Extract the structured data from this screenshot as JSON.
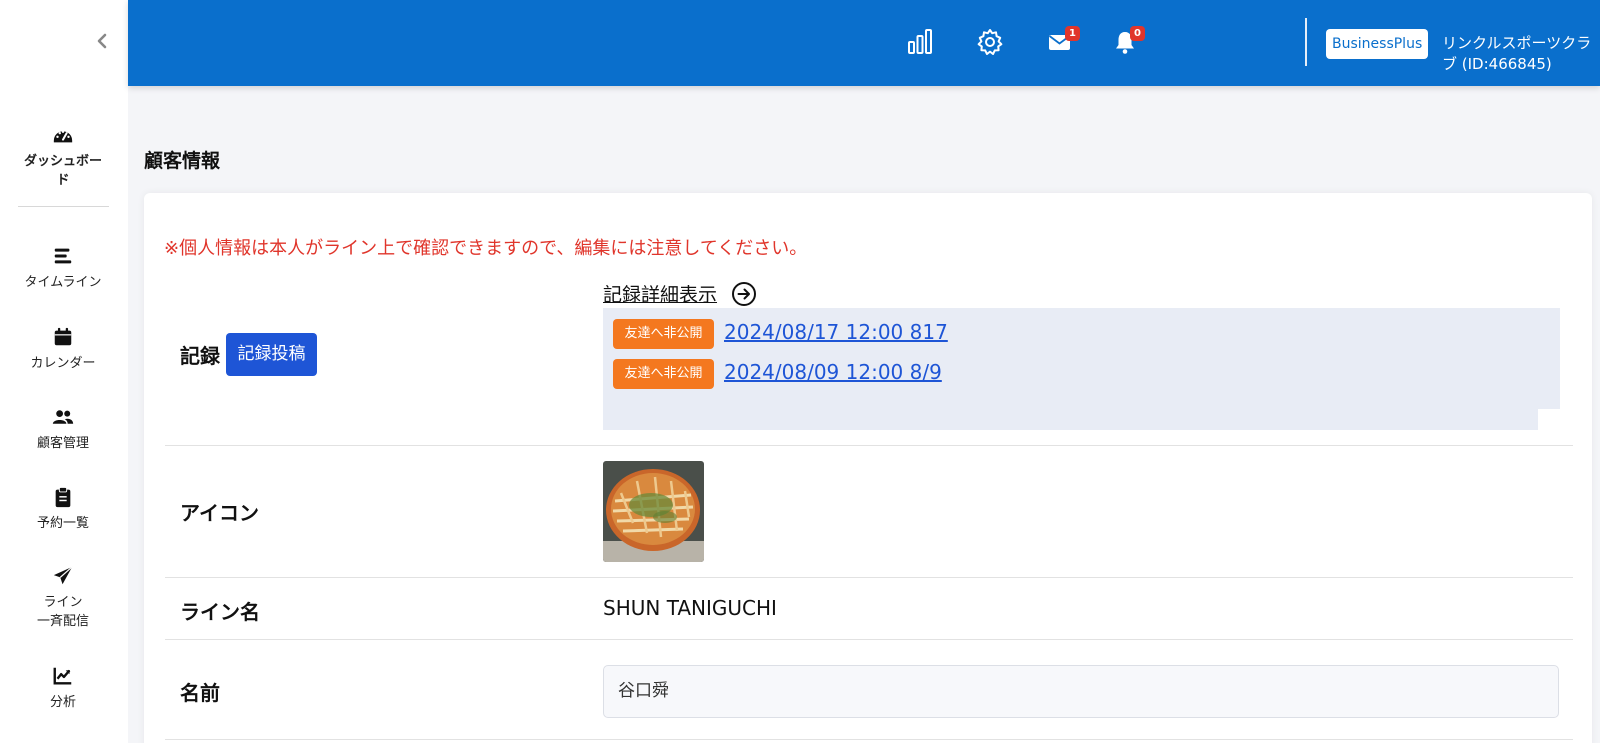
{
  "sidebar": {
    "items": [
      {
        "label": "ダッシュボード",
        "icon": "dashboard-icon"
      },
      {
        "label": "タイムライン",
        "icon": "timeline-icon"
      },
      {
        "label": "カレンダー",
        "icon": "calendar-icon"
      },
      {
        "label": "顧客管理",
        "icon": "users-icon"
      },
      {
        "label": "予約一覧",
        "icon": "clipboard-icon"
      },
      {
        "label": "ライン\n一斉配信",
        "icon": "paper-plane-icon"
      },
      {
        "label": "分析",
        "icon": "chart-line-icon"
      }
    ]
  },
  "header": {
    "icons": [
      {
        "name": "bar-chart-icon"
      },
      {
        "name": "gear-icon"
      },
      {
        "name": "mail-icon",
        "badge": "1"
      },
      {
        "name": "bell-icon",
        "badge": "0"
      }
    ],
    "plan": "BusinessPlus",
    "account": "リンクルスポーツクラブ (ID:466845)",
    "accent_color": "#0a6fcc",
    "badge_color": "#e0352b"
  },
  "page": {
    "title": "顧客情報",
    "notice": "※個人情報は本人がライン上で確認できますので、編集には注意してください。"
  },
  "records": {
    "label": "記録",
    "post_button": "記録投稿",
    "detail_link": "記録詳細表示",
    "items": [
      {
        "badge": "友達へ非公開",
        "text": "2024/08/17 12:00 817"
      },
      {
        "badge": "友達へ非公開",
        "text": "2024/08/09 12:00 8/9"
      }
    ],
    "badge_color": "#f4781f"
  },
  "icon_row": {
    "label": "アイコン"
  },
  "line_name_row": {
    "label": "ライン名",
    "value": "SHUN TANIGUCHI"
  },
  "name_row": {
    "label": "名前",
    "value": "谷口舜"
  }
}
